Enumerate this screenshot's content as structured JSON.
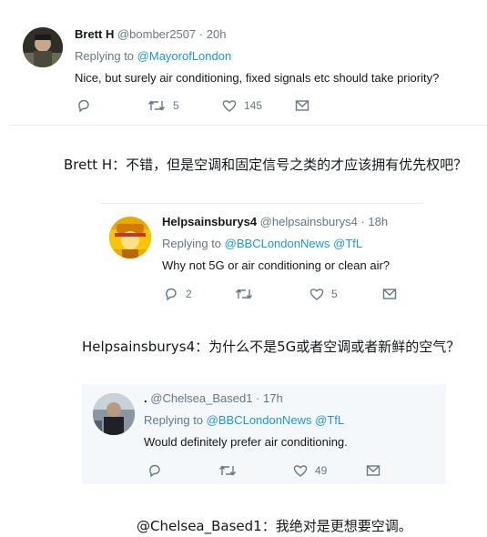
{
  "tweet1": {
    "name": "Brett H",
    "handle": "@bomber2507",
    "time": "· 20h",
    "replying_prefix": "Replying to",
    "replying_to": "@MayorofLondon",
    "text": "Nice, but surely air conditioning, fixed signals etc should take priority?",
    "replies": "",
    "retweets": "5",
    "likes": "145"
  },
  "caption1": "Brett H：不错，但是空调和固定信号之类的才应该拥有优先权吧？",
  "tweet2": {
    "name": "Helpsainsburys4",
    "handle": "@helpsainsburys4",
    "time": "· 18h",
    "replying_prefix": "Replying to",
    "replying_to_1": "@BBCLondonNews",
    "replying_to_2": "@TfL",
    "text": "Why not 5G or air conditioning or clean air?",
    "replies": "2",
    "retweets": "",
    "likes": "5"
  },
  "caption2": "Helpsainsburys4：为什么不是5G或者空调或者新鲜的空气？",
  "tweet3": {
    "name": ".",
    "handle": "@Chelsea_Based1",
    "time": "· 17h",
    "replying_prefix": "Replying to",
    "replying_to_1": "@BBCLondonNews",
    "replying_to_2": "@TfL",
    "text": "Would definitely prefer air conditioning.",
    "replies": "",
    "retweets": "",
    "likes": "49"
  },
  "caption3": "@Chelsea_Based1：我绝对是更想要空调。",
  "colors": {
    "link": "#1b95e0",
    "muted": "#657786",
    "text": "#14171a",
    "box": "#f5f8fa"
  }
}
